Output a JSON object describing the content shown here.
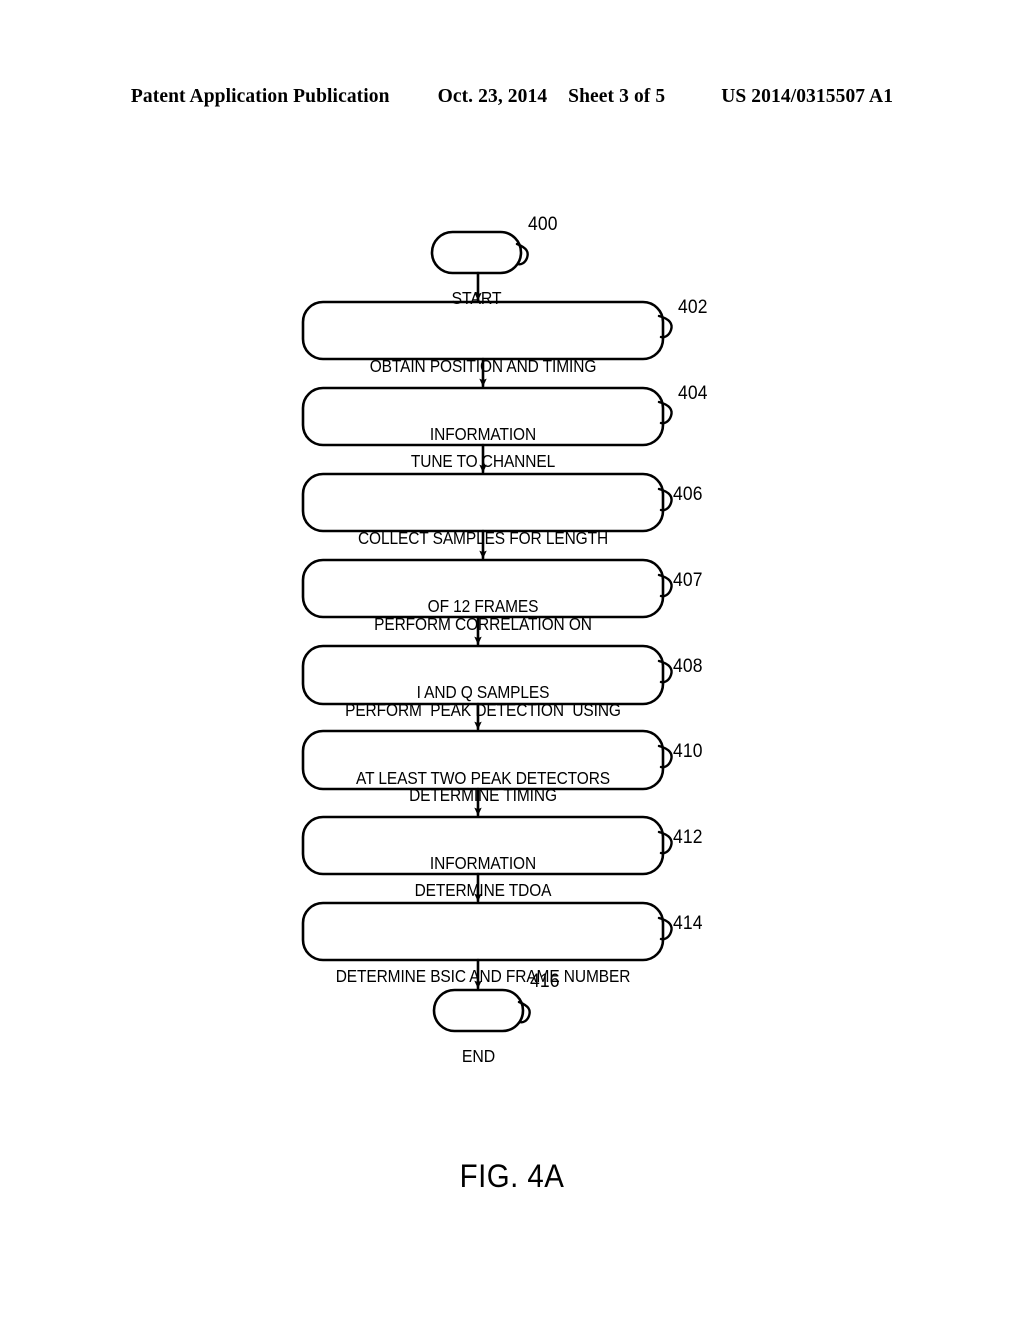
{
  "page": {
    "header": {
      "publication": "Patent Application Publication",
      "date": "Oct. 23, 2014",
      "sheet": "Sheet 3 of 5",
      "patent_number": "US 2014/0315507 A1"
    },
    "caption": "FIG. 4A",
    "background_color": "#ffffff",
    "ink_color": "#000000"
  },
  "flowchart": {
    "diagram_ref": "400",
    "nodes": [
      {
        "id": "start",
        "type": "terminal",
        "label": "START",
        "ref": "400",
        "lines": [
          "START"
        ]
      },
      {
        "id": "step402",
        "type": "process",
        "ref": "402",
        "label": "OBTAIN POSITION AND TIMING INFORMATION",
        "lines": [
          "OBTAIN POSITION AND TIMING",
          "INFORMATION"
        ]
      },
      {
        "id": "step404",
        "type": "process",
        "ref": "404",
        "label": "TUNE TO CHANNEL",
        "lines": [
          "TUNE TO CHANNEL"
        ]
      },
      {
        "id": "step406",
        "type": "process",
        "ref": "406",
        "label": "COLLECT SAMPLES FOR LENGTH OF 12 FRAMES",
        "lines": [
          "COLLECT SAMPLES FOR LENGTH",
          "OF 12 FRAMES"
        ]
      },
      {
        "id": "step407",
        "type": "process",
        "ref": "407",
        "label": "PERFORM CORRELATION ON I AND Q SAMPLES",
        "lines": [
          "PERFORM CORRELATION ON",
          "I AND Q SAMPLES"
        ]
      },
      {
        "id": "step408",
        "type": "process",
        "ref": "408",
        "label": "PERFORM  PEAK DETECTION  USING AT LEAST TWO PEAK DETECTORS",
        "lines": [
          "PERFORM  PEAK DETECTION  USING",
          "AT LEAST TWO PEAK DETECTORS"
        ]
      },
      {
        "id": "step410",
        "type": "process",
        "ref": "410",
        "label": "DETERMINE TIMING INFORMATION",
        "lines": [
          "DETERMINE TIMING",
          "INFORMATION"
        ]
      },
      {
        "id": "step412",
        "type": "process",
        "ref": "412",
        "label": "DETERMINE TDOA",
        "lines": [
          "DETERMINE TDOA"
        ]
      },
      {
        "id": "step414",
        "type": "process",
        "ref": "414",
        "label": "DETERMINE BSIC AND FRAME NUMBER",
        "lines": [
          "DETERMINE BSIC AND FRAME NUMBER"
        ]
      },
      {
        "id": "end",
        "type": "terminal",
        "ref": "416",
        "label": "END",
        "lines": [
          "END"
        ]
      }
    ],
    "connectors": [
      {
        "from": "start",
        "to": "step402"
      },
      {
        "from": "step402",
        "to": "step404"
      },
      {
        "from": "step404",
        "to": "step406"
      },
      {
        "from": "step406",
        "to": "step407"
      },
      {
        "from": "step407",
        "to": "step408"
      },
      {
        "from": "step408",
        "to": "step410"
      },
      {
        "from": "step410",
        "to": "step412"
      },
      {
        "from": "step412",
        "to": "step414"
      },
      {
        "from": "step414",
        "to": "end"
      }
    ]
  }
}
